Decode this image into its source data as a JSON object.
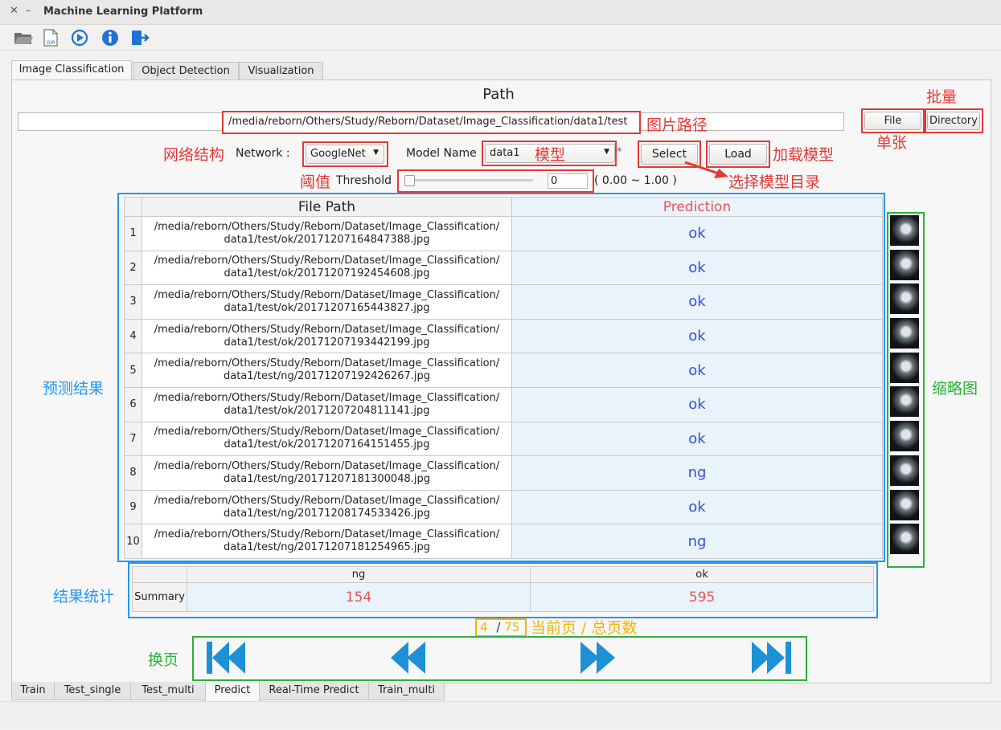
{
  "window": {
    "title": "Machine Learning Platform"
  },
  "toolbar_icons": [
    "folder-open-icon",
    "directory-file-icon",
    "play-circle-icon",
    "info-icon",
    "exit-icon"
  ],
  "top_tabs": [
    "Image Classification",
    "Object Detection",
    "Visualization"
  ],
  "path_section": {
    "heading": "Path",
    "value": "/media/reborn/Others/Study/Reborn/Dataset/Image_Classification/data1/test",
    "file_button": "File",
    "directory_button": "Directory"
  },
  "network": {
    "label": "Network :",
    "selected": "GoogleNet"
  },
  "model": {
    "label": "Model Name",
    "selected": "data1",
    "required_mark": "*"
  },
  "select_button": "Select",
  "load_button": "Load",
  "threshold": {
    "label": "Threshold",
    "value": "0",
    "range": "( 0.00 ~ 1.00 )"
  },
  "table": {
    "headers": [
      "File Path",
      "Prediction"
    ],
    "rows": [
      {
        "index": "1",
        "path1": "/media/reborn/Others/Study/Reborn/Dataset/Image_Classification/",
        "path2": "data1/test/ok/20171207164847388.jpg",
        "prediction": "ok"
      },
      {
        "index": "2",
        "path1": "/media/reborn/Others/Study/Reborn/Dataset/Image_Classification/",
        "path2": "data1/test/ok/20171207192454608.jpg",
        "prediction": "ok"
      },
      {
        "index": "3",
        "path1": "/media/reborn/Others/Study/Reborn/Dataset/Image_Classification/",
        "path2": "data1/test/ok/20171207165443827.jpg",
        "prediction": "ok"
      },
      {
        "index": "4",
        "path1": "/media/reborn/Others/Study/Reborn/Dataset/Image_Classification/",
        "path2": "data1/test/ok/20171207193442199.jpg",
        "prediction": "ok"
      },
      {
        "index": "5",
        "path1": "/media/reborn/Others/Study/Reborn/Dataset/Image_Classification/",
        "path2": "data1/test/ng/20171207192426267.jpg",
        "prediction": "ok"
      },
      {
        "index": "6",
        "path1": "/media/reborn/Others/Study/Reborn/Dataset/Image_Classification/",
        "path2": "data1/test/ok/20171207204811141.jpg",
        "prediction": "ok"
      },
      {
        "index": "7",
        "path1": "/media/reborn/Others/Study/Reborn/Dataset/Image_Classification/",
        "path2": "data1/test/ok/20171207164151455.jpg",
        "prediction": "ok"
      },
      {
        "index": "8",
        "path1": "/media/reborn/Others/Study/Reborn/Dataset/Image_Classification/",
        "path2": "data1/test/ng/20171207181300048.jpg",
        "prediction": "ng"
      },
      {
        "index": "9",
        "path1": "/media/reborn/Others/Study/Reborn/Dataset/Image_Classification/",
        "path2": "data1/test/ng/20171208174533426.jpg",
        "prediction": "ok"
      },
      {
        "index": "10",
        "path1": "/media/reborn/Others/Study/Reborn/Dataset/Image_Classification/",
        "path2": "data1/test/ng/20171207181254965.jpg",
        "prediction": "ng"
      }
    ]
  },
  "summary": {
    "row_label": "Summary",
    "ng_label": "ng",
    "ok_label": "ok",
    "ng_count": "154",
    "ok_count": "595"
  },
  "pagination": {
    "current": "4",
    "separator": "/",
    "total": "75"
  },
  "annotations": {
    "image_path": "图片路径",
    "batch": "批量",
    "single": "单张",
    "network_structure": "网络结构",
    "model": "模型",
    "load_model": "加载模型",
    "threshold": "阈值",
    "select_model_dir": "选择模型目录",
    "prediction_result": "预测结果",
    "thumbnail": "缩略图",
    "result_stats": "结果统计",
    "page_info": "当前页 / 总页数",
    "change_page": "换页"
  },
  "bottom_tabs": [
    "Train",
    "Test_single",
    "Test_multi",
    "Predict",
    "Real-Time Predict",
    "Train_multi"
  ],
  "colors": {
    "accent_blue": "#2196f3",
    "annotation_red": "#e53935",
    "annotation_green": "#2bb03a",
    "prediction_header": "#e8544f",
    "prediction_text": "#3a4fd6",
    "page_box": "#f5b400"
  }
}
